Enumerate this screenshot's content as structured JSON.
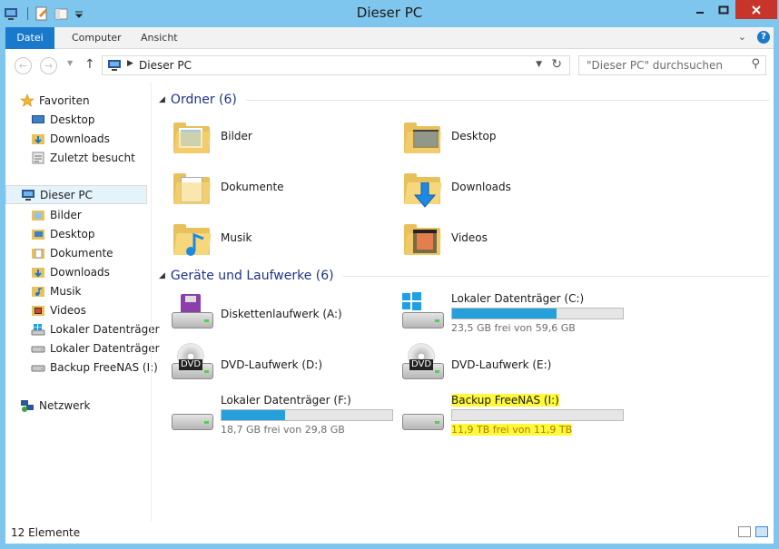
{
  "window": {
    "title": "Dieser PC"
  },
  "ribbon": {
    "tabs": [
      {
        "label": "Datei"
      },
      {
        "label": "Computer"
      },
      {
        "label": "Ansicht"
      }
    ],
    "help_label": "?"
  },
  "nav": {
    "back_label": "←",
    "forward_label": "→",
    "up_label": "↑",
    "address_path": "Dieser PC",
    "search_placeholder": "\"Dieser PC\" durchsuchen"
  },
  "sidebar": {
    "favorites": {
      "label": "Favoriten",
      "items": [
        {
          "label": "Desktop",
          "icon": "desktop-icon"
        },
        {
          "label": "Downloads",
          "icon": "downloads-folder-icon"
        },
        {
          "label": "Zuletzt besucht",
          "icon": "recent-places-icon"
        }
      ]
    },
    "this_pc": {
      "label": "Dieser PC",
      "items": [
        {
          "label": "Bilder",
          "icon": "folder-icon"
        },
        {
          "label": "Desktop",
          "icon": "folder-icon"
        },
        {
          "label": "Dokumente",
          "icon": "folder-icon"
        },
        {
          "label": "Downloads",
          "icon": "folder-icon"
        },
        {
          "label": "Musik",
          "icon": "folder-icon"
        },
        {
          "label": "Videos",
          "icon": "folder-icon"
        },
        {
          "label": "Lokaler Datenträger",
          "icon": "drive-icon"
        },
        {
          "label": "Lokaler Datenträger",
          "icon": "drive-icon"
        },
        {
          "label": "Backup FreeNAS (I:)",
          "icon": "drive-icon"
        }
      ]
    },
    "network": {
      "label": "Netzwerk"
    }
  },
  "content": {
    "folders_group": "Ordner (6)",
    "folders": [
      {
        "label": "Bilder",
        "icon": "pictures-folder-icon"
      },
      {
        "label": "Desktop",
        "icon": "desktop-folder-icon"
      },
      {
        "label": "Dokumente",
        "icon": "documents-folder-icon"
      },
      {
        "label": "Downloads",
        "icon": "downloads-folder-icon"
      },
      {
        "label": "Musik",
        "icon": "music-folder-icon"
      },
      {
        "label": "Videos",
        "icon": "videos-folder-icon"
      }
    ],
    "devices_group": "Geräte und Laufwerke (6)",
    "devices": [
      {
        "label": "Diskettenlaufwerk (A:)",
        "icon": "floppy-drive-icon"
      },
      {
        "label": "Lokaler Datenträger (C:)",
        "icon": "system-drive-icon",
        "used_fraction": 0.61,
        "free_text": "23,5 GB frei von 59,6 GB"
      },
      {
        "label": "DVD-Laufwerk (D:)",
        "icon": "dvd-drive-icon",
        "badge": "DVD"
      },
      {
        "label": "DVD-Laufwerk (E:)",
        "icon": "dvd-drive-icon",
        "badge": "DVD"
      },
      {
        "label": "Lokaler Datenträger (F:)",
        "icon": "drive-icon",
        "used_fraction": 0.37,
        "free_text": "18,7 GB frei von 29,8 GB"
      },
      {
        "label": "Backup FreeNAS (I:)",
        "icon": "drive-icon",
        "used_fraction": 0.0,
        "free_text": "11,9 TB frei von 11,9 TB",
        "highlighted": true
      }
    ]
  },
  "status": {
    "item_count": "12 Elemente"
  },
  "colors": {
    "accent": "#1979ca",
    "bar_fill": "#26a0da",
    "highlight": "#fff93b",
    "group_header": "#1e3287"
  }
}
